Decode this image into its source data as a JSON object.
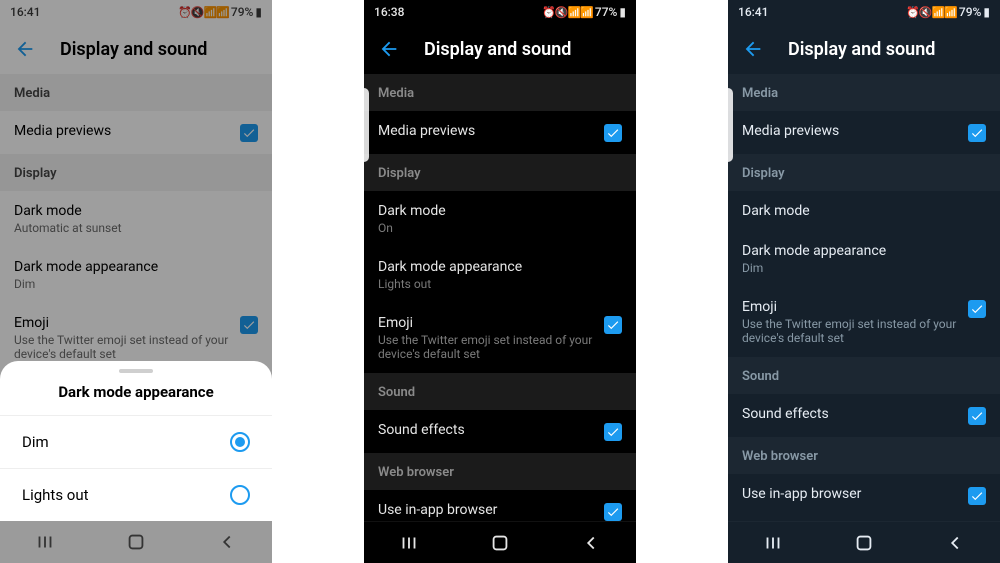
{
  "status": {
    "time1": "16:41",
    "time2": "16:38",
    "time3": "16:41",
    "battery1": "79%",
    "battery2": "77%",
    "battery3": "79%",
    "icons": "⏰ 🔇 📶 📶"
  },
  "header": {
    "title": "Display and sound"
  },
  "sections": {
    "media": "Media",
    "display": "Display",
    "sound": "Sound",
    "web": "Web browser"
  },
  "rows": {
    "mediaPreviews": "Media previews",
    "darkMode": "Dark mode",
    "darkModeSub1": "Automatic at sunset",
    "darkModeSub2": "On",
    "appearance": "Dark mode appearance",
    "appearanceSub1": "Dim",
    "appearanceSub2": "Lights out",
    "appearanceSub3": "Dim",
    "emoji": "Emoji",
    "emojiSub": "Use the Twitter emoji set instead of your device's default set",
    "soundEffects": "Sound effects",
    "inAppBrowser": "Use in-app browser"
  },
  "sheet": {
    "title": "Dark mode appearance",
    "opt1": "Dim",
    "opt2": "Lights out"
  }
}
